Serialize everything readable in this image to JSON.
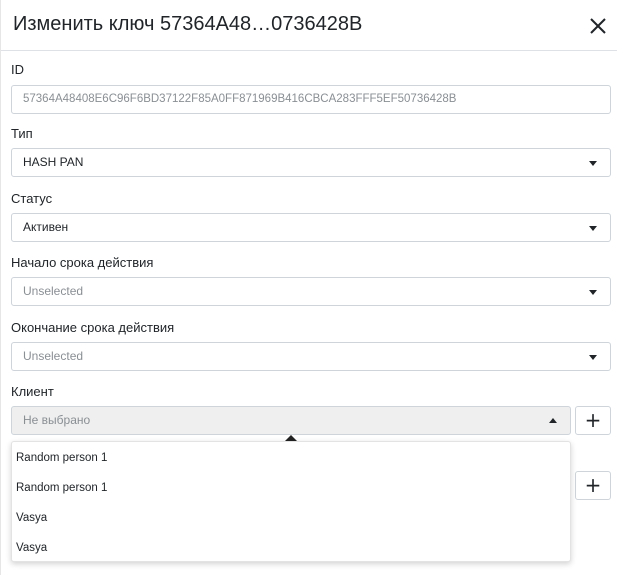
{
  "modal": {
    "title": "Изменить ключ 57364A48…0736428B",
    "close_icon": "close-icon"
  },
  "fields": {
    "id": {
      "label": "ID",
      "value": "57364A48408E6C96F6BD37122F85A0FF871969B416CBCA283FFF5EF50736428B"
    },
    "type": {
      "label": "Тип",
      "value": "HASH PAN"
    },
    "status": {
      "label": "Статус",
      "value": "Активен"
    },
    "start_date": {
      "label": "Начало срока действия",
      "value": "Unselected"
    },
    "end_date": {
      "label": "Окончание срока действия",
      "value": "Unselected"
    },
    "client": {
      "label": "Клиент",
      "value": "Не выбрано",
      "add_label": "+"
    },
    "second_add_label": "+"
  },
  "client_options": [
    "Random person 1",
    "Random person 1",
    "Vasya",
    "Vasya"
  ],
  "colors": {
    "border": "#ced4da",
    "placeholder": "#8a8f94",
    "text": "#212529",
    "open_select_bg": "#efefef"
  }
}
